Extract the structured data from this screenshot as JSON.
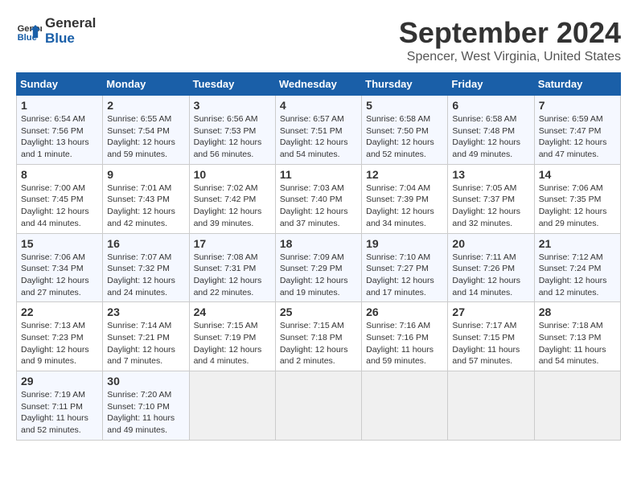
{
  "header": {
    "logo_line1": "General",
    "logo_line2": "Blue",
    "month_title": "September 2024",
    "location": "Spencer, West Virginia, United States"
  },
  "weekdays": [
    "Sunday",
    "Monday",
    "Tuesday",
    "Wednesday",
    "Thursday",
    "Friday",
    "Saturday"
  ],
  "weeks": [
    [
      {
        "day": "1",
        "sunrise": "Sunrise: 6:54 AM",
        "sunset": "Sunset: 7:56 PM",
        "daylight": "Daylight: 13 hours and 1 minute."
      },
      {
        "day": "2",
        "sunrise": "Sunrise: 6:55 AM",
        "sunset": "Sunset: 7:54 PM",
        "daylight": "Daylight: 12 hours and 59 minutes."
      },
      {
        "day": "3",
        "sunrise": "Sunrise: 6:56 AM",
        "sunset": "Sunset: 7:53 PM",
        "daylight": "Daylight: 12 hours and 56 minutes."
      },
      {
        "day": "4",
        "sunrise": "Sunrise: 6:57 AM",
        "sunset": "Sunset: 7:51 PM",
        "daylight": "Daylight: 12 hours and 54 minutes."
      },
      {
        "day": "5",
        "sunrise": "Sunrise: 6:58 AM",
        "sunset": "Sunset: 7:50 PM",
        "daylight": "Daylight: 12 hours and 52 minutes."
      },
      {
        "day": "6",
        "sunrise": "Sunrise: 6:58 AM",
        "sunset": "Sunset: 7:48 PM",
        "daylight": "Daylight: 12 hours and 49 minutes."
      },
      {
        "day": "7",
        "sunrise": "Sunrise: 6:59 AM",
        "sunset": "Sunset: 7:47 PM",
        "daylight": "Daylight: 12 hours and 47 minutes."
      }
    ],
    [
      {
        "day": "8",
        "sunrise": "Sunrise: 7:00 AM",
        "sunset": "Sunset: 7:45 PM",
        "daylight": "Daylight: 12 hours and 44 minutes."
      },
      {
        "day": "9",
        "sunrise": "Sunrise: 7:01 AM",
        "sunset": "Sunset: 7:43 PM",
        "daylight": "Daylight: 12 hours and 42 minutes."
      },
      {
        "day": "10",
        "sunrise": "Sunrise: 7:02 AM",
        "sunset": "Sunset: 7:42 PM",
        "daylight": "Daylight: 12 hours and 39 minutes."
      },
      {
        "day": "11",
        "sunrise": "Sunrise: 7:03 AM",
        "sunset": "Sunset: 7:40 PM",
        "daylight": "Daylight: 12 hours and 37 minutes."
      },
      {
        "day": "12",
        "sunrise": "Sunrise: 7:04 AM",
        "sunset": "Sunset: 7:39 PM",
        "daylight": "Daylight: 12 hours and 34 minutes."
      },
      {
        "day": "13",
        "sunrise": "Sunrise: 7:05 AM",
        "sunset": "Sunset: 7:37 PM",
        "daylight": "Daylight: 12 hours and 32 minutes."
      },
      {
        "day": "14",
        "sunrise": "Sunrise: 7:06 AM",
        "sunset": "Sunset: 7:35 PM",
        "daylight": "Daylight: 12 hours and 29 minutes."
      }
    ],
    [
      {
        "day": "15",
        "sunrise": "Sunrise: 7:06 AM",
        "sunset": "Sunset: 7:34 PM",
        "daylight": "Daylight: 12 hours and 27 minutes."
      },
      {
        "day": "16",
        "sunrise": "Sunrise: 7:07 AM",
        "sunset": "Sunset: 7:32 PM",
        "daylight": "Daylight: 12 hours and 24 minutes."
      },
      {
        "day": "17",
        "sunrise": "Sunrise: 7:08 AM",
        "sunset": "Sunset: 7:31 PM",
        "daylight": "Daylight: 12 hours and 22 minutes."
      },
      {
        "day": "18",
        "sunrise": "Sunrise: 7:09 AM",
        "sunset": "Sunset: 7:29 PM",
        "daylight": "Daylight: 12 hours and 19 minutes."
      },
      {
        "day": "19",
        "sunrise": "Sunrise: 7:10 AM",
        "sunset": "Sunset: 7:27 PM",
        "daylight": "Daylight: 12 hours and 17 minutes."
      },
      {
        "day": "20",
        "sunrise": "Sunrise: 7:11 AM",
        "sunset": "Sunset: 7:26 PM",
        "daylight": "Daylight: 12 hours and 14 minutes."
      },
      {
        "day": "21",
        "sunrise": "Sunrise: 7:12 AM",
        "sunset": "Sunset: 7:24 PM",
        "daylight": "Daylight: 12 hours and 12 minutes."
      }
    ],
    [
      {
        "day": "22",
        "sunrise": "Sunrise: 7:13 AM",
        "sunset": "Sunset: 7:23 PM",
        "daylight": "Daylight: 12 hours and 9 minutes."
      },
      {
        "day": "23",
        "sunrise": "Sunrise: 7:14 AM",
        "sunset": "Sunset: 7:21 PM",
        "daylight": "Daylight: 12 hours and 7 minutes."
      },
      {
        "day": "24",
        "sunrise": "Sunrise: 7:15 AM",
        "sunset": "Sunset: 7:19 PM",
        "daylight": "Daylight: 12 hours and 4 minutes."
      },
      {
        "day": "25",
        "sunrise": "Sunrise: 7:15 AM",
        "sunset": "Sunset: 7:18 PM",
        "daylight": "Daylight: 12 hours and 2 minutes."
      },
      {
        "day": "26",
        "sunrise": "Sunrise: 7:16 AM",
        "sunset": "Sunset: 7:16 PM",
        "daylight": "Daylight: 11 hours and 59 minutes."
      },
      {
        "day": "27",
        "sunrise": "Sunrise: 7:17 AM",
        "sunset": "Sunset: 7:15 PM",
        "daylight": "Daylight: 11 hours and 57 minutes."
      },
      {
        "day": "28",
        "sunrise": "Sunrise: 7:18 AM",
        "sunset": "Sunset: 7:13 PM",
        "daylight": "Daylight: 11 hours and 54 minutes."
      }
    ],
    [
      {
        "day": "29",
        "sunrise": "Sunrise: 7:19 AM",
        "sunset": "Sunset: 7:11 PM",
        "daylight": "Daylight: 11 hours and 52 minutes."
      },
      {
        "day": "30",
        "sunrise": "Sunrise: 7:20 AM",
        "sunset": "Sunset: 7:10 PM",
        "daylight": "Daylight: 11 hours and 49 minutes."
      },
      null,
      null,
      null,
      null,
      null
    ]
  ]
}
